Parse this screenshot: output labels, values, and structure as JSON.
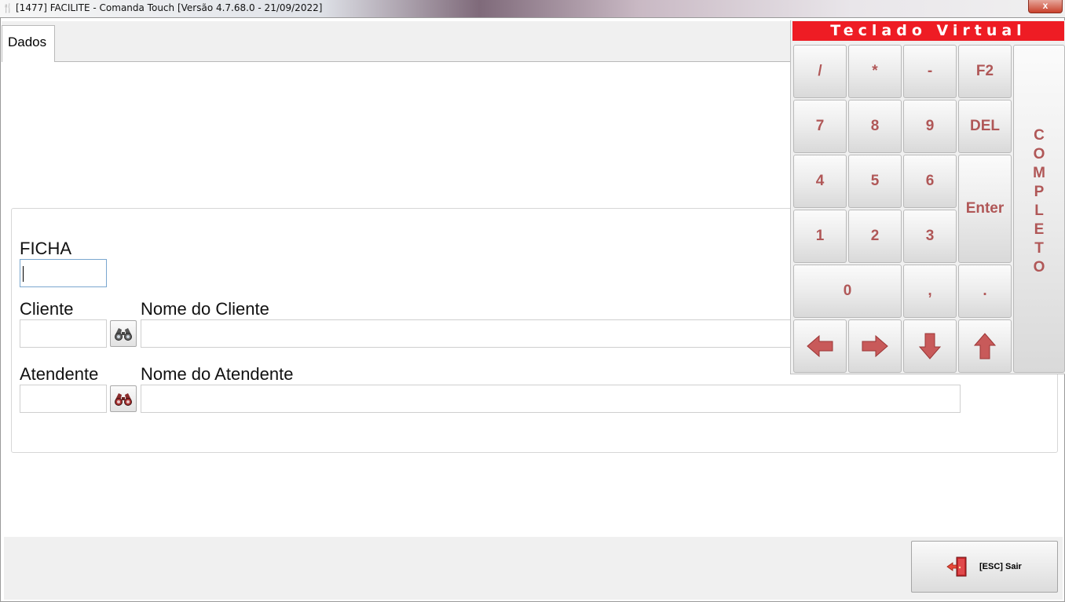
{
  "window": {
    "title": "[1477] FACILITE - Comanda Touch [Versão 4.7.68.0 - 21/09/2022]",
    "close_label": "x"
  },
  "tabs": [
    {
      "label": "Dados",
      "selected": true
    }
  ],
  "form": {
    "ficha_label": "FICHA",
    "ficha_value": "",
    "cliente_label": "Cliente",
    "cliente_value": "",
    "nome_cliente_label": "Nome do Cliente",
    "nome_cliente_value": "",
    "atendente_label": "Atendente",
    "atendente_value": "",
    "nome_atendente_label": "Nome do Atendente",
    "nome_atendente_value": ""
  },
  "keyboard": {
    "title": "Teclado Virtual",
    "keys": {
      "slash": "/",
      "asterisk": "*",
      "minus": "-",
      "f2": "F2",
      "k7": "7",
      "k8": "8",
      "k9": "9",
      "del": "DEL",
      "k4": "4",
      "k5": "5",
      "k6": "6",
      "enter": "Enter",
      "k1": "1",
      "k2": "2",
      "k3": "3",
      "k0": "0",
      "comma": ",",
      "dot": "."
    },
    "completo": [
      "C",
      "O",
      "M",
      "P",
      "L",
      "E",
      "T",
      "O"
    ]
  },
  "footer": {
    "exit_label": "[ESC] Sair"
  },
  "colors": {
    "accent_red": "#ee1c24",
    "key_text": "#b05757"
  }
}
